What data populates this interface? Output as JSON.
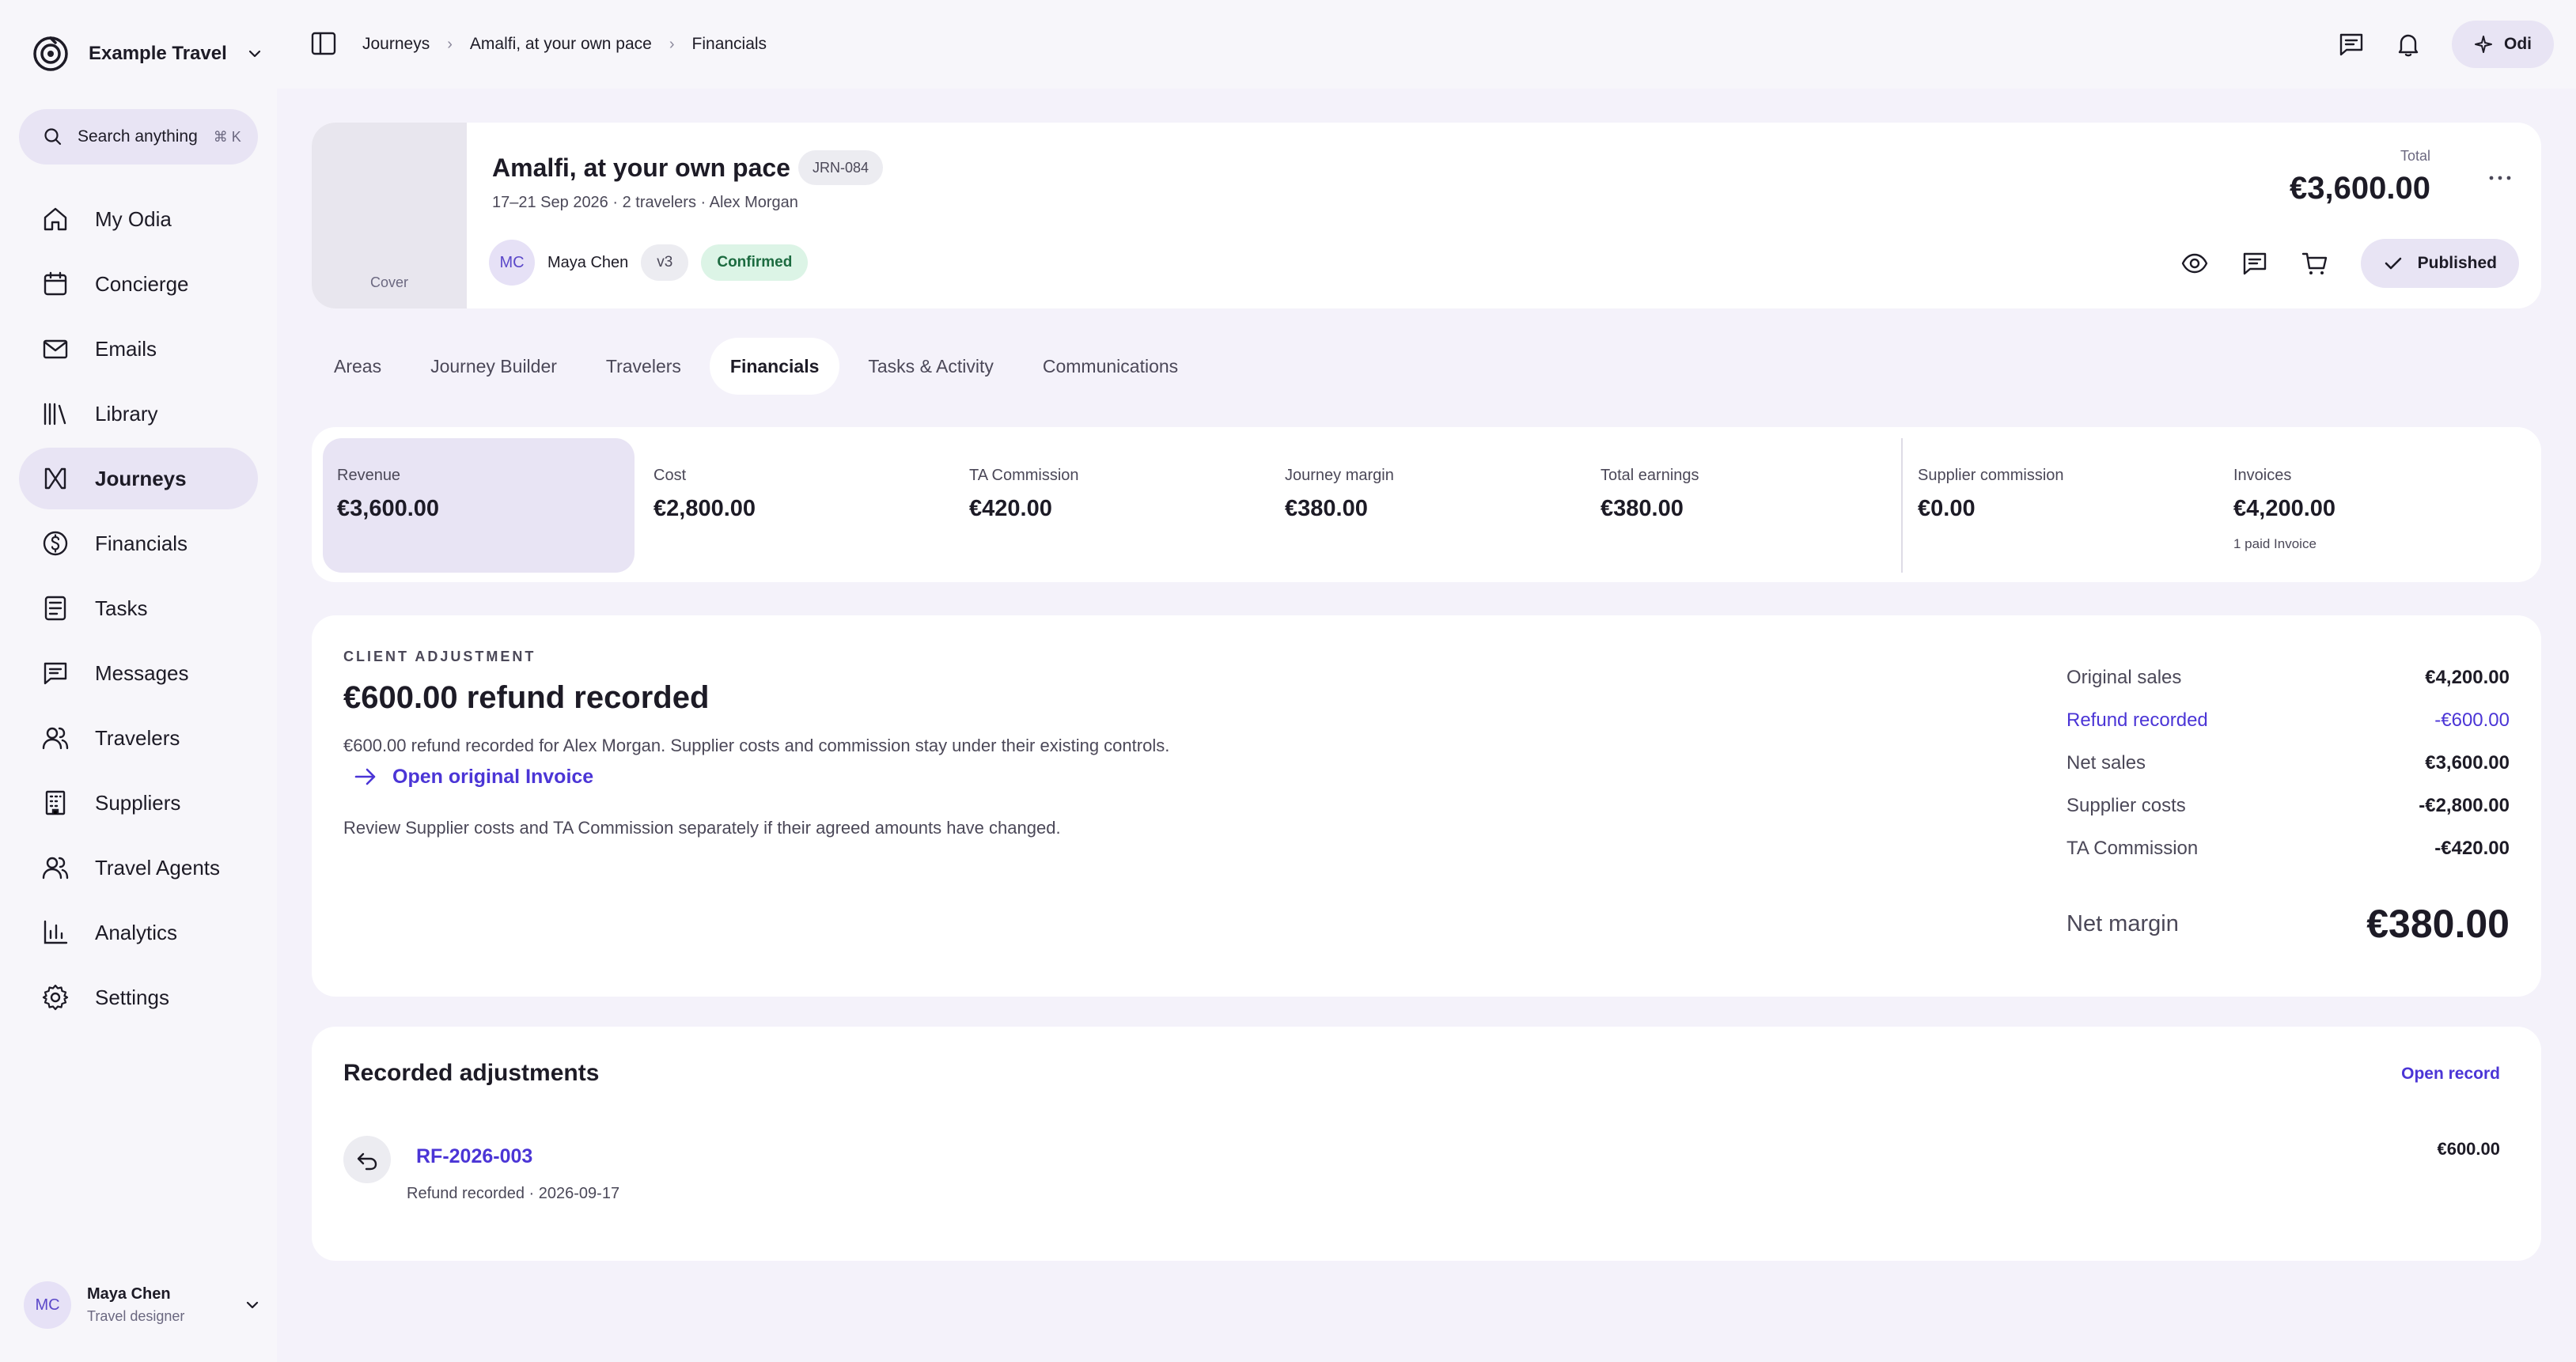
{
  "brand": {
    "name": "Example Travel"
  },
  "search": {
    "label": "Search anything",
    "shortcut": "⌘ K"
  },
  "sidebar": {
    "items": [
      {
        "label": "My Odia",
        "icon": "home-icon"
      },
      {
        "label": "Concierge",
        "icon": "calendar-icon"
      },
      {
        "label": "Emails",
        "icon": "mail-icon"
      },
      {
        "label": "Library",
        "icon": "library-icon"
      },
      {
        "label": "Journeys",
        "icon": "journeys-icon",
        "active": true
      },
      {
        "label": "Financials",
        "icon": "dollar-circle-icon"
      },
      {
        "label": "Tasks",
        "icon": "tasks-icon"
      },
      {
        "label": "Messages",
        "icon": "message-icon"
      },
      {
        "label": "Travelers",
        "icon": "users-icon"
      },
      {
        "label": "Suppliers",
        "icon": "building-icon"
      },
      {
        "label": "Travel Agents",
        "icon": "users-icon"
      },
      {
        "label": "Analytics",
        "icon": "bar-chart-icon"
      },
      {
        "label": "Settings",
        "icon": "gear-icon"
      }
    ]
  },
  "user": {
    "initials": "MC",
    "name": "Maya Chen",
    "role": "Travel designer"
  },
  "breadcrumb": [
    "Journeys",
    "Amalfi, at your own pace",
    "Financials"
  ],
  "topbar": {
    "assistant_label": "Odi"
  },
  "journey": {
    "cover_label": "Cover",
    "title": "Amalfi, at your own pace",
    "code": "JRN-084",
    "meta": "17–21 Sep 2026 · 2 travelers · Alex Morgan",
    "owner_initials": "MC",
    "owner_name": "Maya Chen",
    "version": "v3",
    "status": "Confirmed",
    "total_label": "Total",
    "total_value": "€3,600.00",
    "published_label": "Published"
  },
  "tabs": [
    {
      "label": "Areas"
    },
    {
      "label": "Journey Builder"
    },
    {
      "label": "Travelers"
    },
    {
      "label": "Financials",
      "active": true
    },
    {
      "label": "Tasks & Activity"
    },
    {
      "label": "Communications"
    }
  ],
  "metrics": [
    {
      "label": "Revenue",
      "value": "€3,600.00",
      "selected": true
    },
    {
      "label": "Cost",
      "value": "€2,800.00"
    },
    {
      "label": "TA Commission",
      "value": "€420.00"
    },
    {
      "label": "Journey margin",
      "value": "€380.00"
    },
    {
      "label": "Total earnings",
      "value": "€380.00"
    },
    {
      "label": "Supplier commission",
      "value": "€0.00"
    },
    {
      "label": "Invoices",
      "value": "€4,200.00",
      "sub": "1 paid Invoice"
    }
  ],
  "adjustment": {
    "eyebrow": "CLIENT ADJUSTMENT",
    "title": "€600.00 refund recorded",
    "description": "€600.00 refund recorded for Alex Morgan. Supplier costs and commission stay under their existing controls.",
    "link_label": "Open original Invoice",
    "note": "Review Supplier costs and TA Commission separately if their agreed amounts have changed.",
    "summary": [
      {
        "label": "Original sales",
        "value": "€4,200.00"
      },
      {
        "label": "Refund recorded",
        "value": "-€600.00",
        "highlight": true
      },
      {
        "label": "Net sales",
        "value": "€3,600.00"
      },
      {
        "label": "Supplier costs",
        "value": "-€2,800.00"
      },
      {
        "label": "TA Commission",
        "value": "-€420.00"
      }
    ],
    "net_label": "Net margin",
    "net_value": "€380.00"
  },
  "records": {
    "title": "Recorded adjustments",
    "open_label": "Open record",
    "items": [
      {
        "id": "RF-2026-003",
        "meta": "Refund recorded · 2026-09-17",
        "amount": "€600.00"
      }
    ]
  },
  "colors": {
    "accent": "#4b35d6",
    "active_bg": "#e8e4f4",
    "status_confirmed_bg": "#dcf4e6",
    "status_confirmed_text": "#1c6b40",
    "page_bg": "#f4f2fa"
  }
}
